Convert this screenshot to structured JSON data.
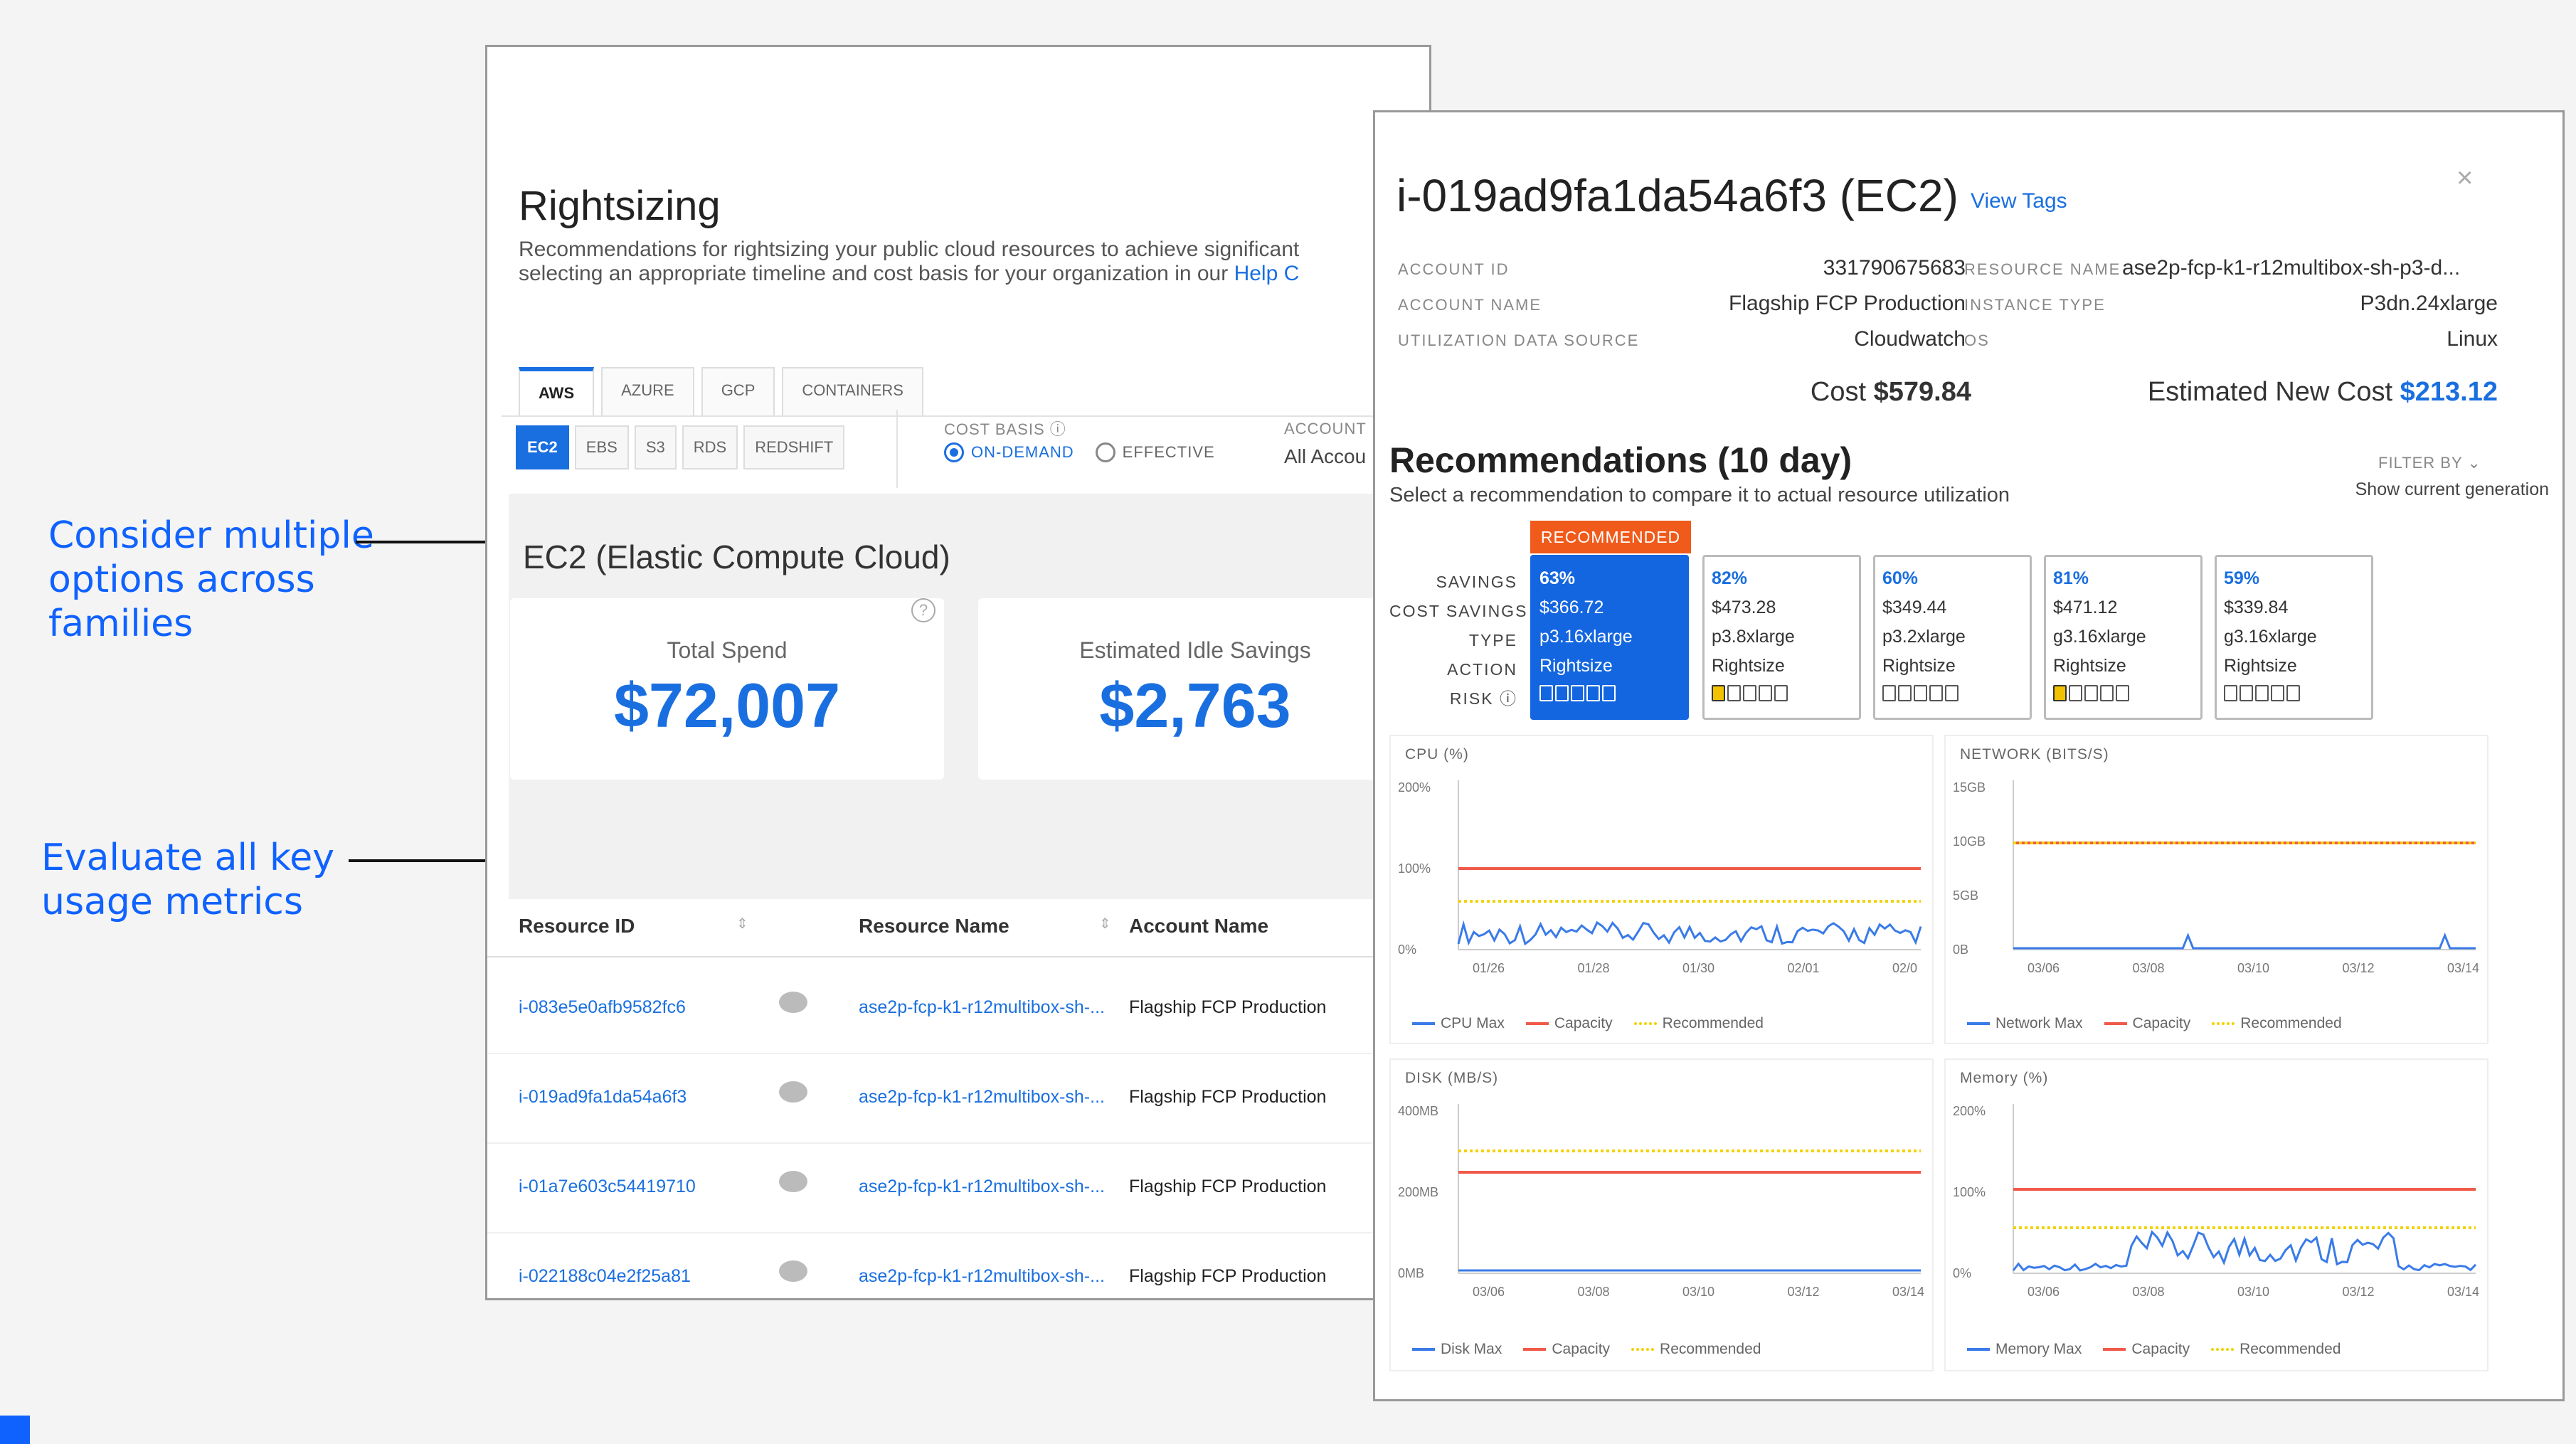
{
  "annotations": {
    "first": [
      "Consider multiple",
      "options across",
      "families"
    ],
    "second": [
      "Evaluate all key",
      "usage metrics"
    ]
  },
  "left": {
    "title": "Rightsizing",
    "desc_line1": "Recommendations for rightsizing your public cloud resources to achieve significant",
    "desc_line2_prefix": "selecting an appropriate timeline and cost basis for your organization in our ",
    "desc_link": "Help C",
    "tabs": [
      "AWS",
      "AZURE",
      "GCP",
      "CONTAINERS"
    ],
    "subtabs": [
      "EC2",
      "EBS",
      "S3",
      "RDS",
      "REDSHIFT"
    ],
    "cost_basis_label": "COST BASIS",
    "cost_basis_options": [
      "ON-DEMAND",
      "EFFECTIVE"
    ],
    "account_label": "ACCOUNT",
    "account_value": "All Accou",
    "section_title": "EC2 (Elastic Compute Cloud)",
    "total_spend_label": "Total Spend",
    "total_spend_value": "$72,007",
    "idle_savings_label": "Estimated Idle Savings",
    "idle_savings_value": "$2,763",
    "help_icon": "?",
    "table_headers": [
      "Resource ID",
      "Resource Name",
      "Account Name"
    ],
    "rows": [
      {
        "id": "i-083e5e0afb9582fc6",
        "name": "ase2p-fcp-k1-r12multibox-sh-...",
        "account": "Flagship FCP Production"
      },
      {
        "id": "i-019ad9fa1da54a6f3",
        "name": "ase2p-fcp-k1-r12multibox-sh-...",
        "account": "Flagship FCP Production"
      },
      {
        "id": "i-01a7e603c54419710",
        "name": "ase2p-fcp-k1-r12multibox-sh-...",
        "account": "Flagship FCP Production"
      },
      {
        "id": "i-022188c04e2f25a81",
        "name": "ase2p-fcp-k1-r12multibox-sh-...",
        "account": "Flagship FCP Production"
      }
    ]
  },
  "right": {
    "title": "i-019ad9fa1da54a6f3 (EC2)",
    "view_tags": "View Tags",
    "close": "×",
    "account_id_label": "ACCOUNT ID",
    "account_id": "331790675683",
    "account_name_label": "ACCOUNT NAME",
    "account_name": "Flagship FCP Production",
    "util_source_label": "UTILIZATION DATA SOURCE",
    "util_source": "Cloudwatch",
    "resource_name_label": "RESOURCE NAME",
    "resource_name": "ase2p-fcp-k1-r12multibox-sh-p3-d...",
    "instance_type_label": "INSTANCE TYPE",
    "instance_type": "P3dn.24xlarge",
    "os_label": "OS",
    "os": "Linux",
    "cost_label": "Cost",
    "cost": "$579.84",
    "new_cost_label": "Estimated New Cost",
    "new_cost": "$213.12",
    "rec_title": "Recommendations (10 day)",
    "rec_sub": "Select a recommendation to compare it to actual resource utilization",
    "filter_label": "FILTER BY",
    "filter_value": "Show current generation",
    "row_labels": [
      "SAVINGS",
      "COST SAVINGS",
      "TYPE",
      "ACTION",
      "RISK"
    ],
    "recommended_badge": "RECOMMENDED",
    "cards": [
      {
        "pct": "63%",
        "savings": "$366.72",
        "type": "p3.16xlarge",
        "action": "Rightsize",
        "risk": 0
      },
      {
        "pct": "82%",
        "savings": "$473.28",
        "type": "p3.8xlarge",
        "action": "Rightsize",
        "risk": 1
      },
      {
        "pct": "60%",
        "savings": "$349.44",
        "type": "p3.2xlarge",
        "action": "Rightsize",
        "risk": 0
      },
      {
        "pct": "81%",
        "savings": "$471.12",
        "type": "g3.16xlarge",
        "action": "Rightsize",
        "risk": 1
      },
      {
        "pct": "59%",
        "savings": "$339.84",
        "type": "g3.16xlarge",
        "action": "Rightsize",
        "risk": 0
      }
    ],
    "charts": {
      "cpu": {
        "title": "CPU (%)",
        "yticks": [
          "200%",
          "100%",
          "0%"
        ],
        "xticks": [
          "01/26",
          "01/28",
          "01/30",
          "02/01",
          "02/0"
        ],
        "legend": [
          "CPU Max",
          "Capacity",
          "Recommended"
        ]
      },
      "network": {
        "title": "NETWORK (BITS/S)",
        "yticks": [
          "15GB",
          "10GB",
          "5GB",
          "0B"
        ],
        "xticks": [
          "03/06",
          "03/08",
          "03/10",
          "03/12",
          "03/14"
        ],
        "legend": [
          "Network Max",
          "Capacity",
          "Recommended"
        ]
      },
      "disk": {
        "title": "DISK (MB/S)",
        "yticks": [
          "400MB",
          "200MB",
          "0MB"
        ],
        "xticks": [
          "03/06",
          "03/08",
          "03/10",
          "03/12",
          "03/14"
        ],
        "legend": [
          "Disk Max",
          "Capacity",
          "Recommended"
        ]
      },
      "memory": {
        "title": "Memory (%)",
        "yticks": [
          "200%",
          "100%",
          "0%"
        ],
        "xticks": [
          "03/06",
          "03/08",
          "03/10",
          "03/12",
          "03/14"
        ],
        "legend": [
          "Memory Max",
          "Capacity",
          "Recommended"
        ]
      }
    }
  },
  "colors": {
    "blue": "#1a6fe0",
    "red": "#f05a4a",
    "yellow": "#f2d200",
    "accent": "#0f62fe",
    "badge": "#f05a1a"
  }
}
